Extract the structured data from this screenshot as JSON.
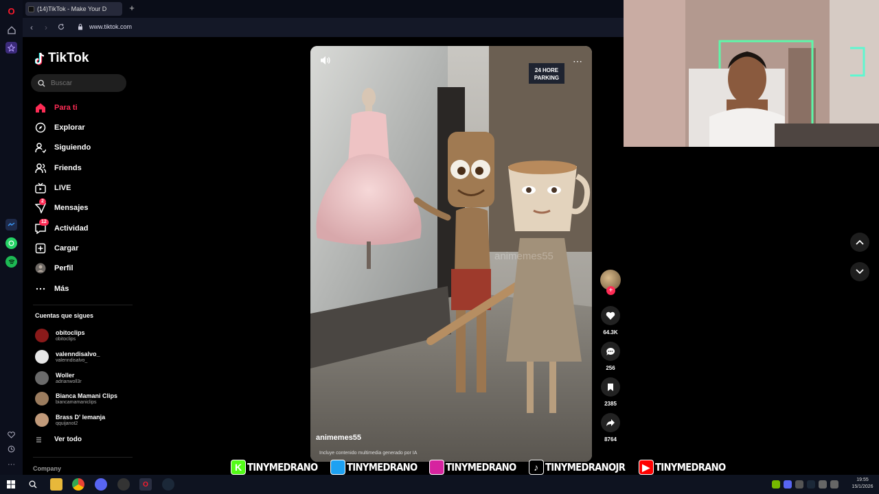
{
  "browser": {
    "tab_title": "(14)TikTok - Make Your D",
    "url": "www.tiktok.com",
    "new_tab_icon": "plus-icon"
  },
  "tiktok": {
    "logo_text": "TikTok",
    "search_placeholder": "Buscar",
    "nav": [
      {
        "label": "Para ti",
        "icon": "home-icon",
        "active": true
      },
      {
        "label": "Explorar",
        "icon": "compass-icon"
      },
      {
        "label": "Siguiendo",
        "icon": "following-icon"
      },
      {
        "label": "Friends",
        "icon": "friends-icon"
      },
      {
        "label": "LIVE",
        "icon": "live-icon"
      },
      {
        "label": "Mensajes",
        "icon": "messages-icon",
        "badge": "2"
      },
      {
        "label": "Actividad",
        "icon": "activity-icon",
        "badge": "12"
      },
      {
        "label": "Cargar",
        "icon": "upload-icon"
      },
      {
        "label": "Perfil",
        "icon": "profile-icon"
      },
      {
        "label": "Más",
        "icon": "more-icon"
      }
    ],
    "following_title": "Cuentas que sigues",
    "following": [
      {
        "name": "obitoclips",
        "handle": "obitoclips",
        "color": "#8a1a1a"
      },
      {
        "name": "valenndisalvo_",
        "handle": "valenndisalvo_",
        "color": "#e6e6e6"
      },
      {
        "name": "Woller",
        "handle": "adrianwoll3r",
        "color": "#6a6a6a"
      },
      {
        "name": "Bianca Mamani Clips",
        "handle": "biancamamaniclips",
        "color": "#9b7c5e"
      },
      {
        "name": "Brass D' lemanja",
        "handle": "qquijanot2",
        "color": "#c19a7a"
      }
    ],
    "see_all": "Ver todo",
    "company": "Company"
  },
  "video": {
    "author": "animemes55",
    "ai_label": "Incluye contenido multimedia generado por IA",
    "watermark": "animemes55",
    "store_sign": "24 HORE PARKING"
  },
  "actions": {
    "likes": "64.3K",
    "comments": "256",
    "saves": "2385",
    "shares": "8764"
  },
  "social_bar": [
    {
      "icon": "kick-icon",
      "glyph": "K",
      "color": "#53fc18",
      "name": "TINYMEDRANO"
    },
    {
      "icon": "twitter-icon",
      "glyph": "",
      "color": "#1da1f2",
      "name": "TINYMEDRANO"
    },
    {
      "icon": "instagram-icon",
      "glyph": "",
      "color": "#d6249f",
      "name": "TINYMEDRANO"
    },
    {
      "icon": "tiktok-icon",
      "glyph": "♪",
      "color": "#000000",
      "name": "TINYMEDRANOJR"
    },
    {
      "icon": "youtube-icon",
      "glyph": "▶",
      "color": "#ff0000",
      "name": "TINYMEDRANO"
    }
  ],
  "taskbar": {
    "time": "19:55",
    "date": "15/1/2026"
  },
  "colors": {
    "accent": "#fe2c55",
    "background": "#000000"
  }
}
